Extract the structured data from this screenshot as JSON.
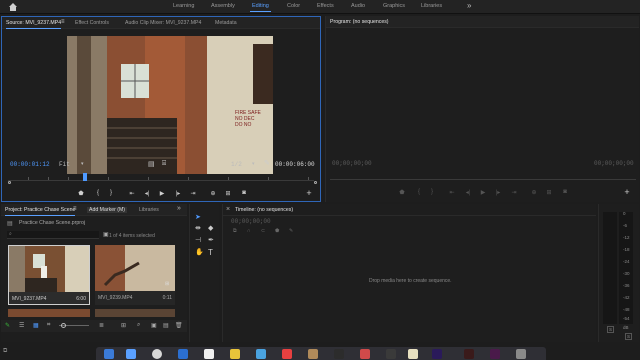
{
  "workspaces": {
    "tabs": [
      {
        "label": "Learning"
      },
      {
        "label": "Assembly"
      },
      {
        "label": "Editing"
      },
      {
        "label": "Color"
      },
      {
        "label": "Effects"
      },
      {
        "label": "Audio"
      },
      {
        "label": "Graphics"
      },
      {
        "label": "Libraries"
      }
    ],
    "more": "»"
  },
  "source_panel": {
    "tabs": [
      {
        "label": "Source: MVI_9237.MP4"
      },
      {
        "label": "Effect Controls"
      },
      {
        "label": "Audio Clip Mixer: MVI_9237.MP4"
      },
      {
        "label": "Metadata"
      }
    ],
    "timecode_in": "00:00:01:12",
    "fit": "Fit",
    "resolution": "1/2",
    "duration": "00:00:06:00",
    "video_sign_text": "FIRE SAFE\nNO DEC\nDO NO"
  },
  "program_panel": {
    "title": "Program: (no sequences)",
    "timecode_left": "00;00;00;00",
    "timecode_right": "00;00;00;00"
  },
  "project_panel": {
    "tabs": [
      {
        "label": "Project: Practice Chase Scene"
      },
      {
        "label": "Add Marker (M)"
      },
      {
        "label": "Libraries"
      }
    ],
    "file_name": "Practice Chase Scene.prproj",
    "items_status": "1 of 4 items selected",
    "clips": [
      {
        "name": "MVI_9237.MP4",
        "duration": "6:00"
      },
      {
        "name": "MVI_9239.MP4",
        "duration": "0:11"
      }
    ]
  },
  "timeline_panel": {
    "title": "Timeline: (no sequences)",
    "timecode": "00;00;00;00",
    "empty_message": "Drop media here to create sequence."
  },
  "audio_meter": {
    "labels": [
      "0",
      "-6",
      "-12",
      "-18",
      "-24",
      "-30",
      "-36",
      "-42",
      "-48",
      "-54"
    ],
    "bottom": "dB",
    "channels": [
      "S",
      "S"
    ]
  },
  "colors": {
    "accent": "#4f9aff",
    "panel_bg": "#1e1e1e",
    "active_border": "#2f66b8"
  }
}
